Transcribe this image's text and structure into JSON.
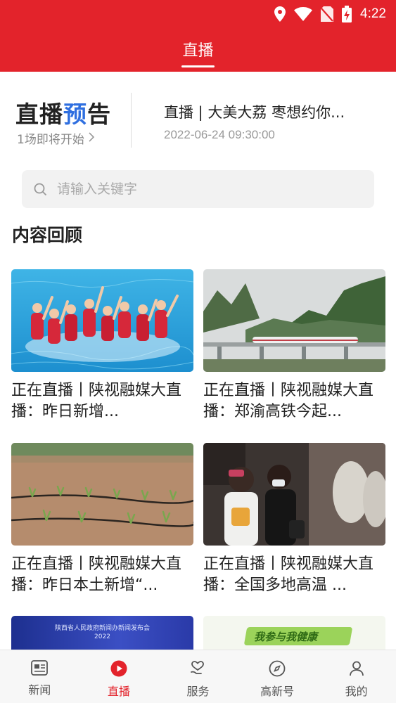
{
  "status_bar": {
    "time": "4:22"
  },
  "header": {
    "title": "直播"
  },
  "preview": {
    "title_part1": "直播",
    "title_part2": "预",
    "title_part3": "告",
    "subtitle": "1场即将开始",
    "item_title": "直播 | 大美大荔 枣想约你...",
    "item_time": "2022-06-24 09:30:00",
    "accent_color": "#2f6fe0"
  },
  "search": {
    "placeholder": "请输入关键字",
    "value": ""
  },
  "section": {
    "title": "内容回顾"
  },
  "cards": [
    {
      "title": "正在直播丨陕视融媒大直播：昨日新增...",
      "image": "synchronized-swimming-photo"
    },
    {
      "title": "正在直播丨陕视融媒大直播：郑渝高铁今起...",
      "image": "high-speed-train-bridge-photo"
    },
    {
      "title": "正在直播丨陕视融媒大直播：昨日本土新增“...",
      "image": "farmland-irrigation-photo"
    },
    {
      "title": "正在直播丨陕视融媒大直播：全国多地高温 ...",
      "image": "people-sun-shielding-photo"
    }
  ],
  "partial_cards": [
    {
      "caption": "陕西省人民政府新闻办新闻发布会",
      "year": "2022"
    },
    {
      "caption": "我参与我健康"
    }
  ],
  "tabbar": {
    "items": [
      {
        "label": "新闻",
        "icon": "news-icon"
      },
      {
        "label": "直播",
        "icon": "live-play-icon"
      },
      {
        "label": "服务",
        "icon": "service-heart-icon"
      },
      {
        "label": "高新号",
        "icon": "compass-icon"
      },
      {
        "label": "我的",
        "icon": "profile-icon"
      }
    ]
  },
  "colors": {
    "brand": "#e3232b",
    "text": "#222222",
    "muted": "#999999"
  }
}
